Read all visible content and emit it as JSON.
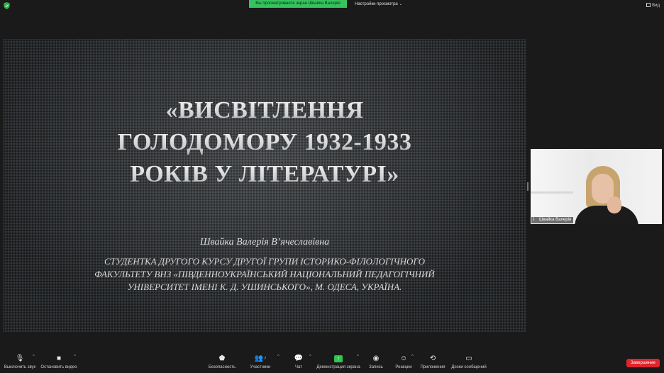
{
  "topbar": {
    "share_banner": "Вы просматриваете экран Швайка Валерія",
    "view_settings": "Настройки просмотра",
    "view_button": "Вид"
  },
  "slide": {
    "title_lines": [
      "«ВИСВІТЛЕННЯ",
      "ГОЛОДОМОРУ 1932-1933",
      "РОКІВ У ЛІТЕРАТУРІ»"
    ],
    "author": "Швайка Валерія В’ячеславівна",
    "description_lines": [
      "СТУДЕНТКА ДРУГОГО КУРСУ ДРУГОЇ ГРУПИ ІСТОРИКО-ФІЛОЛОГІЧНОГО",
      "ФАКУЛЬТЕТУ ВНЗ «ПІВДЕННОУКРАЇНСЬКИЙ НАЦІОНАЛЬНИЙ ПЕДАГОГІЧНИЙ",
      "УНІВЕРСИТЕТ ІМЕНІ К. Д. УШИНСЬКОГО», М. ОДЕСА, УКРАЇНА."
    ],
    "controls": [
      "previous",
      "next",
      "pen",
      "slides",
      "zoom",
      "more"
    ]
  },
  "participant": {
    "name": "Швайка Валерія"
  },
  "toolbar": {
    "mute": "Выключить звук",
    "stop_video": "Остановить видео",
    "security": "Безопасность",
    "participants": "Участники",
    "participants_count": "7",
    "chat": "Чат",
    "share_screen": "Демонстрация экрана",
    "record": "Запись",
    "reactions": "Реакции",
    "apps": "Приложения",
    "whiteboards": "Доски сообщений",
    "end": "Завершение"
  },
  "colors": {
    "share_green": "#36c25e",
    "end_red": "#e0252c",
    "background": "#1a1a1a"
  }
}
